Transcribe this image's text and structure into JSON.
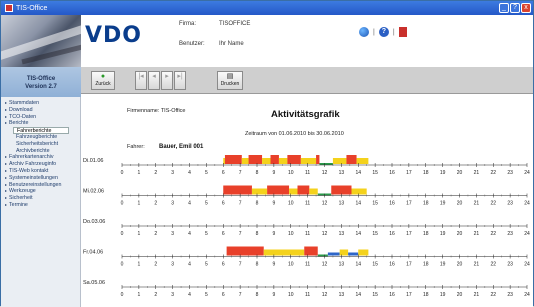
{
  "window": {
    "title": "TIS-Office",
    "buttons": [
      "_",
      "?",
      "x"
    ]
  },
  "header": {
    "logo": "VDO",
    "firma_label": "Firma:",
    "firma_value": "TISOFFICE",
    "benutzer_label": "Benutzer:",
    "benutzer_value": "Ihr Name",
    "icon_sep": "|"
  },
  "sidebar": {
    "app_name": "TIS-Office",
    "version": "Version 2.7",
    "items": [
      {
        "label": "Stammdaten",
        "level": 0
      },
      {
        "label": "Download",
        "level": 0
      },
      {
        "label": "TCO-Daten",
        "level": 0
      },
      {
        "label": "Berichte",
        "level": 0
      },
      {
        "label": "Fahrerberichte",
        "level": 1,
        "selected": true
      },
      {
        "label": "Fahrzeugberichte",
        "level": 1
      },
      {
        "label": "Sicherheitsbericht",
        "level": 1
      },
      {
        "label": "Archivberichte",
        "level": 1
      },
      {
        "label": "Fahrerkartenarchiv",
        "level": 0
      },
      {
        "label": "Archiv Fahrzeuginfo",
        "level": 0
      },
      {
        "label": "TIS-Web kontakt",
        "level": 0
      },
      {
        "label": "Systemeinstellungen",
        "level": 0
      },
      {
        "label": "Benutzereinstellungen",
        "level": 0
      },
      {
        "label": "Werkzeuge",
        "level": 0
      },
      {
        "label": "Sicherheit",
        "level": 0
      },
      {
        "label": "Termine",
        "level": 0
      }
    ]
  },
  "toolbar": {
    "back_label": "Zurück",
    "nav_glyphs": [
      "|◂",
      "◂",
      "▸",
      "▸|"
    ],
    "print_label": "Drucken"
  },
  "report": {
    "firm_line": "Firmenname: TIS-Office",
    "title": "Aktivitätsgrafik",
    "range": "Zeitraum von 01.06.2010 bis 30.06.2010",
    "driver_label": "Fahrer:",
    "driver_value": "Bauer, Emil 001"
  },
  "colors": {
    "drive": "#e8402a",
    "work": "#f4d21c",
    "available": "#2e66c8",
    "rest": "#2a9a4a"
  },
  "chart_data": {
    "type": "timeline",
    "hours": [
      0,
      1,
      2,
      3,
      4,
      5,
      6,
      7,
      8,
      9,
      10,
      11,
      12,
      13,
      14,
      15,
      16,
      17,
      18,
      19,
      20,
      21,
      22,
      23,
      24
    ],
    "days": [
      {
        "label": "Di.01.06",
        "segments": [
          {
            "start": 6.0,
            "end": 7.0,
            "act": "work"
          },
          {
            "start": 6.1,
            "end": 7.1,
            "act": "drive"
          },
          {
            "start": 7.1,
            "end": 7.5,
            "act": "work"
          },
          {
            "start": 7.5,
            "end": 8.3,
            "act": "drive"
          },
          {
            "start": 8.3,
            "end": 8.8,
            "act": "work"
          },
          {
            "start": 8.8,
            "end": 9.3,
            "act": "drive"
          },
          {
            "start": 9.3,
            "end": 9.8,
            "act": "work"
          },
          {
            "start": 9.8,
            "end": 10.6,
            "act": "drive"
          },
          {
            "start": 10.6,
            "end": 11.5,
            "act": "work"
          },
          {
            "start": 11.5,
            "end": 11.7,
            "act": "drive"
          },
          {
            "start": 11.7,
            "end": 12.5,
            "act": "rest"
          },
          {
            "start": 12.5,
            "end": 13.3,
            "act": "work"
          },
          {
            "start": 13.3,
            "end": 13.9,
            "act": "drive"
          },
          {
            "start": 13.9,
            "end": 14.6,
            "act": "work"
          }
        ]
      },
      {
        "label": "Mi.02.06",
        "segments": [
          {
            "start": 6.0,
            "end": 7.7,
            "act": "drive"
          },
          {
            "start": 7.7,
            "end": 8.6,
            "act": "work"
          },
          {
            "start": 8.6,
            "end": 9.9,
            "act": "drive"
          },
          {
            "start": 9.9,
            "end": 10.4,
            "act": "work"
          },
          {
            "start": 10.4,
            "end": 11.1,
            "act": "drive"
          },
          {
            "start": 11.1,
            "end": 11.6,
            "act": "work"
          },
          {
            "start": 11.6,
            "end": 12.4,
            "act": "rest"
          },
          {
            "start": 12.4,
            "end": 13.6,
            "act": "drive"
          },
          {
            "start": 13.6,
            "end": 14.5,
            "act": "work"
          }
        ]
      },
      {
        "label": "Do.03.06",
        "segments": []
      },
      {
        "label": "Fr.04.06",
        "segments": [
          {
            "start": 6.2,
            "end": 8.4,
            "act": "drive"
          },
          {
            "start": 8.4,
            "end": 10.8,
            "act": "work"
          },
          {
            "start": 10.8,
            "end": 11.6,
            "act": "drive"
          },
          {
            "start": 11.6,
            "end": 12.2,
            "act": "rest"
          },
          {
            "start": 12.2,
            "end": 12.9,
            "act": "available"
          },
          {
            "start": 12.9,
            "end": 13.4,
            "act": "work"
          },
          {
            "start": 13.4,
            "end": 14.0,
            "act": "available"
          },
          {
            "start": 14.0,
            "end": 14.6,
            "act": "work"
          }
        ]
      },
      {
        "label": "Sa.05.06",
        "segments": []
      }
    ]
  }
}
